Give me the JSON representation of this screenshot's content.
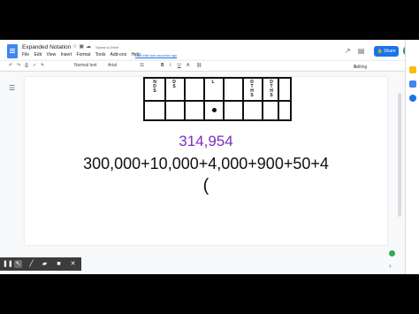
{
  "app": {
    "doc_title": "Expanded Notation",
    "saved_status": "Saved to Drive",
    "last_edit": "Last edit was seconds ago",
    "menu": [
      "File",
      "Edit",
      "View",
      "Insert",
      "Format",
      "Tools",
      "Add-ons",
      "Help"
    ],
    "share_label": "Share",
    "mode_label": "Editing"
  },
  "toolbar": {
    "style_label": "Normal text",
    "font_label": "Arial",
    "font_size": "11",
    "bold": "B",
    "italic": "I",
    "underline": "U",
    "text_color": "A"
  },
  "document": {
    "column_headers": [
      "NDS",
      "DS",
      "",
      "L",
      "",
      "DTHS",
      "DTHS"
    ],
    "number": "314,954",
    "expanded_form": "300,000+10,000+4,000+900+50+4",
    "next_line": "("
  },
  "colors": {
    "number_color": "#7b2fbe",
    "share_button": "#1a73e8",
    "doc_icon": "#4285f4"
  },
  "icons": [
    "docs-logo-icon",
    "star-icon",
    "move-folder-icon",
    "cloud-saved-icon",
    "activity-icon",
    "comment-icon",
    "present-icon",
    "lock-icon",
    "avatar",
    "outline-icon",
    "undo-icon",
    "redo-icon",
    "print-icon",
    "spellcheck-icon",
    "paint-format-icon",
    "link-icon",
    "pencil-icon",
    "pause-icon",
    "pointer-icon",
    "pen-icon",
    "highlighter-icon",
    "camera-icon",
    "close-icon"
  ]
}
